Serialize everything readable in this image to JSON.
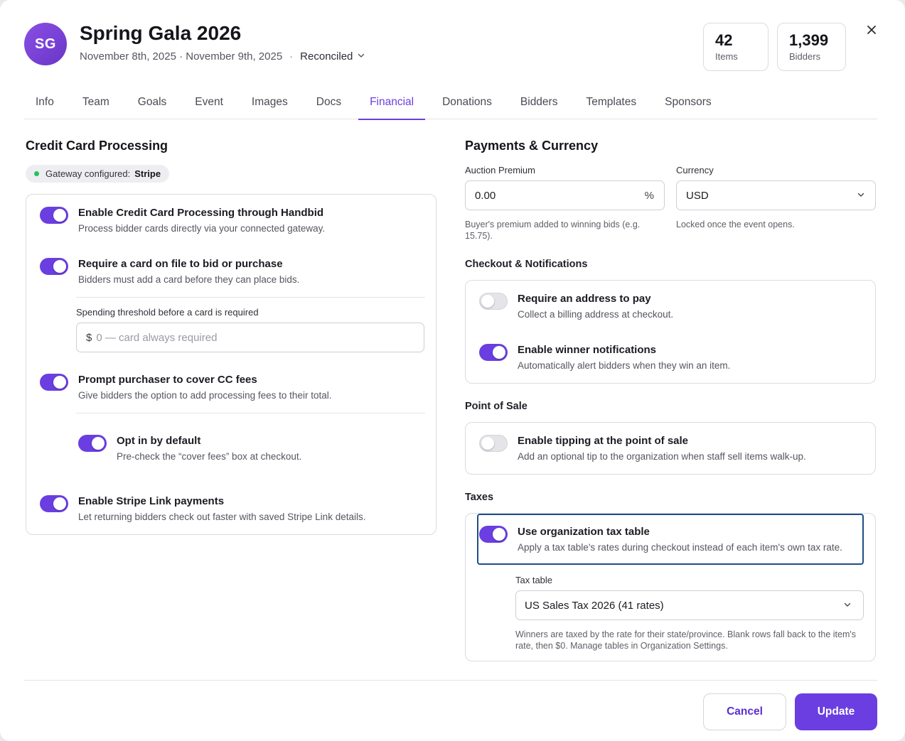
{
  "header": {
    "avatar_initials": "SG",
    "title": "Spring Gala 2026",
    "dates": "November 8th, 2025 · November 9th, 2025",
    "separator": "·",
    "status": "Reconciled",
    "stats": [
      {
        "value": "42",
        "label": "Items"
      },
      {
        "value": "1,399",
        "label": "Bidders"
      }
    ]
  },
  "tabs": [
    "Info",
    "Team",
    "Goals",
    "Event",
    "Images",
    "Docs",
    "Financial",
    "Donations",
    "Bidders",
    "Templates",
    "Sponsors"
  ],
  "active_tab": "Financial",
  "credit": {
    "heading": "Credit Card Processing",
    "gateway_prefix": "Gateway configured:",
    "gateway_name": "Stripe",
    "enable_cc": {
      "title": "Enable Credit Card Processing through Handbid",
      "desc": "Process bidder cards directly via your connected gateway.",
      "on": true
    },
    "require_card": {
      "title": "Require a card on file to bid or purchase",
      "desc": "Bidders must add a card before they can place bids.",
      "on": true
    },
    "threshold": {
      "label": "Spending threshold before a card is required",
      "currency_symbol": "$",
      "placeholder": "0 — card always required"
    },
    "cover_fees": {
      "title": "Prompt purchaser to cover CC fees",
      "desc": "Give bidders the option to add processing fees to their total.",
      "on": true
    },
    "opt_in": {
      "title": "Opt in by default",
      "desc": "Pre-check the “cover fees” box at checkout.",
      "on": true
    },
    "stripe_link": {
      "title": "Enable Stripe Link payments",
      "desc": "Let returning bidders check out faster with saved Stripe Link details.",
      "on": true
    }
  },
  "payments": {
    "heading": "Payments & Currency",
    "premium_label": "Auction Premium",
    "premium_value": "0.00",
    "premium_unit": "%",
    "premium_help": "Buyer's premium added to winning bids (e.g. 15.75).",
    "currency_label": "Currency",
    "currency_value": "USD",
    "currency_help": "Locked once the event opens."
  },
  "checkout": {
    "heading": "Checkout & Notifications",
    "address": {
      "title": "Require an address to pay",
      "desc": "Collect a billing address at checkout.",
      "on": false
    },
    "winner": {
      "title": "Enable winner notifications",
      "desc": "Automatically alert bidders when they win an item.",
      "on": true
    }
  },
  "pos": {
    "heading": "Point of Sale",
    "tipping": {
      "title": "Enable tipping at the point of sale",
      "desc": "Add an optional tip to the organization when staff sell items walk-up.",
      "on": false
    }
  },
  "taxes": {
    "heading": "Taxes",
    "org_table": {
      "title": "Use organization tax table",
      "desc": "Apply a tax table's rates during checkout instead of each item's own tax rate.",
      "on": true
    },
    "table_label": "Tax table",
    "table_value": "US Sales Tax 2026 (41 rates)",
    "table_help": "Winners are taxed by the rate for their state/province. Blank rows fall back to the item's rate, then $0. Manage tables in Organization Settings."
  },
  "footer": {
    "cancel": "Cancel",
    "update": "Update"
  },
  "colors": {
    "accent": "#6a3ee0",
    "focus": "#1f4e86",
    "gateway_ok": "#22c35e"
  }
}
